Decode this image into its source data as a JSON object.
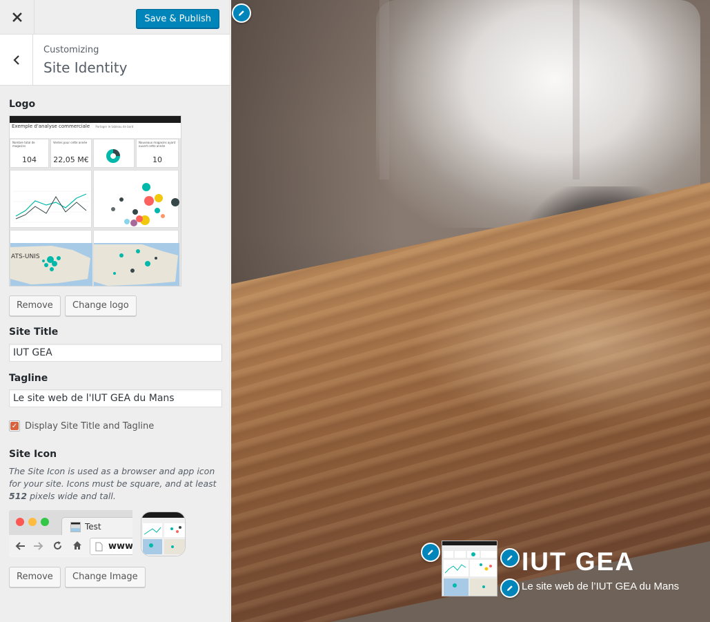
{
  "header": {
    "save_label": "Save & Publish"
  },
  "section": {
    "crumb": "Customizing",
    "title": "Site Identity"
  },
  "logo": {
    "label": "Logo",
    "remove_label": "Remove",
    "change_label": "Change logo",
    "preview": {
      "title": "Exemple d'analyse commerciale",
      "share": "Partager le tableau de bord",
      "kpis": [
        {
          "caption": "Nombre total de magasins",
          "value": "104"
        },
        {
          "caption": "Ventes pour cette année",
          "value": "22,05 M€"
        },
        {
          "caption": "Nouveaux magasins ayant ouvert cette année",
          "value": "10"
        }
      ],
      "map_label": "ATS-UNIS"
    }
  },
  "site_title": {
    "label": "Site Title",
    "value": "IUT GEA"
  },
  "tagline": {
    "label": "Tagline",
    "value": "Le site web de l'IUT GEA du Mans"
  },
  "display_title": {
    "label": "Display Site Title and Tagline",
    "checked": true
  },
  "site_icon": {
    "label": "Site Icon",
    "desc_part1": "The Site Icon is used as a browser and app icon for your site. Icons must be square, and at least ",
    "desc_bold": "512",
    "desc_part2": " pixels wide and tall.",
    "browser_tab_label": "Test",
    "browser_url": "www.",
    "remove_label": "Remove",
    "change_label": "Change Image"
  },
  "preview": {
    "site_title": "IUT GEA",
    "tagline": "Le site web de l’IUT GEA du Mans"
  },
  "colors": {
    "primary": "#0085ba",
    "checkbox": "#d9633f",
    "sidebar_bg": "#eeeeee"
  },
  "icons": [
    "close-icon",
    "chevron-left-icon",
    "pencil-icon",
    "checkmark-icon",
    "back-arrow-icon",
    "forward-arrow-icon",
    "reload-icon",
    "home-icon",
    "page-icon"
  ]
}
